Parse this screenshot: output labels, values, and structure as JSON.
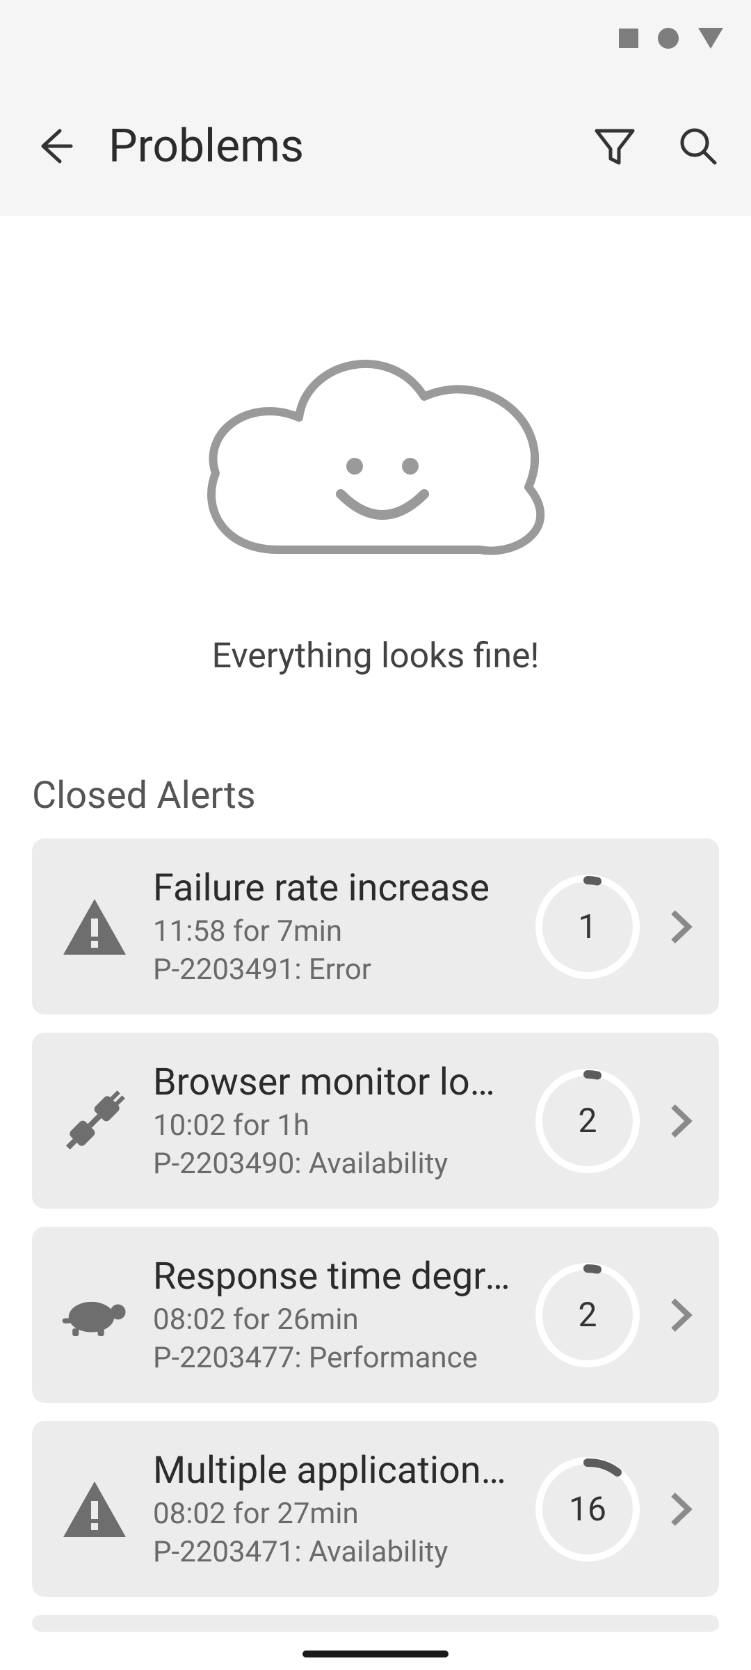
{
  "header": {
    "title": "Problems"
  },
  "empty_state": {
    "message": "Everything looks fine!"
  },
  "section": {
    "title": "Closed Alerts"
  },
  "alerts": [
    {
      "icon": "warning-triangle",
      "title": "Failure rate increase",
      "time": "11:58 for 7min",
      "meta": "P-2203491: Error",
      "count": "1",
      "ring_fraction": 0.02
    },
    {
      "icon": "plug",
      "title": "Browser monitor loc...",
      "time": "10:02 for 1h",
      "meta": "P-2203490: Availability",
      "count": "2",
      "ring_fraction": 0.02
    },
    {
      "icon": "turtle",
      "title": "Response time degra...",
      "time": "08:02 for 26min",
      "meta": "P-2203477: Performance",
      "count": "2",
      "ring_fraction": 0.02
    },
    {
      "icon": "warning-triangle",
      "title": "Multiple application ...",
      "time": "08:02 for 27min",
      "meta": "P-2203471: Availability",
      "count": "16",
      "ring_fraction": 0.12
    }
  ],
  "colors": {
    "card_bg": "#ececec",
    "icon_gray": "#6e6e6e",
    "ring_white": "#ffffff",
    "ring_tick": "#5c5c5c"
  }
}
